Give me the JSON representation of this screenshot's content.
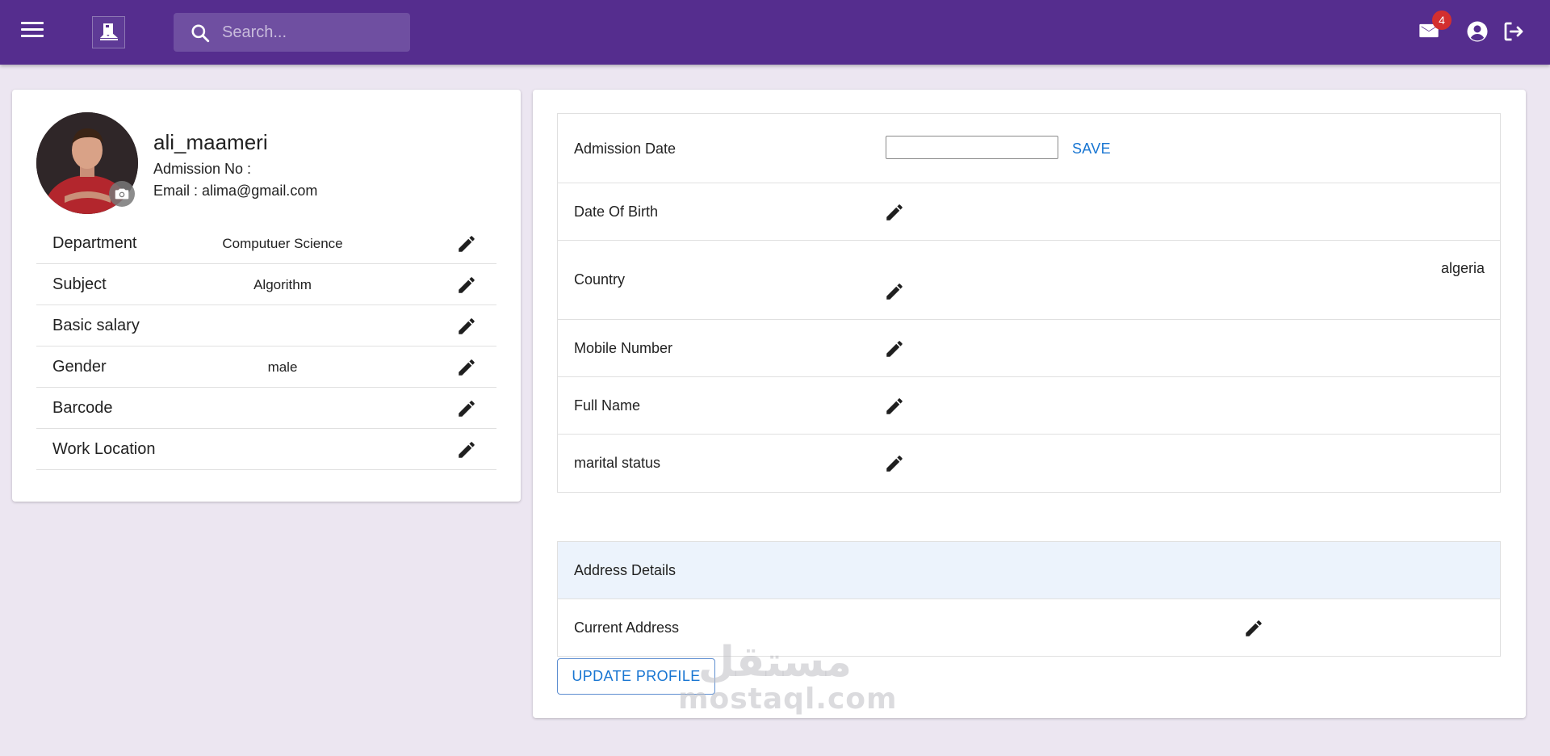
{
  "topbar": {
    "search_placeholder": "Search...",
    "notification_count": "4",
    "colors": {
      "bar": "#552d8e",
      "badge": "#d32f2f"
    },
    "icons": [
      "menu-icon",
      "logo-icon",
      "search-icon",
      "mail-icon",
      "account-icon",
      "logout-icon"
    ]
  },
  "profile": {
    "username": "ali_maameri",
    "admission_no": "Admission No :",
    "email": "Email : alima@gmail.com",
    "fields": [
      {
        "label": "Department",
        "value": "Computuer Science"
      },
      {
        "label": "Subject",
        "value": "Algorithm"
      },
      {
        "label": "Basic salary",
        "value": ""
      },
      {
        "label": "Gender",
        "value": "male"
      },
      {
        "label": "Barcode",
        "value": ""
      },
      {
        "label": "Work Location",
        "value": ""
      }
    ]
  },
  "details": {
    "admission_date_label": "Admission Date",
    "admission_date_value": "",
    "save_label": "SAVE",
    "rows": [
      {
        "label": "Date Of Birth",
        "value": ""
      },
      {
        "label": "Country",
        "value": "algeria"
      },
      {
        "label": "Mobile Number",
        "value": ""
      },
      {
        "label": "Full Name",
        "value": ""
      },
      {
        "label": "marital status",
        "value": ""
      }
    ]
  },
  "address": {
    "heading": "Address Details",
    "current_label": "Current Address",
    "current_value": ""
  },
  "actions": {
    "update_label": "UPDATE PROFILE"
  },
  "watermark": {
    "latin": "mostaql.com",
    "arabic": "مستقل"
  },
  "accent_color": "#1976d2"
}
